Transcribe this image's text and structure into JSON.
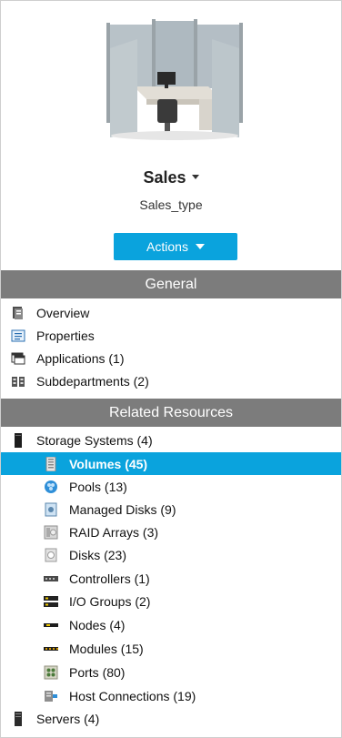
{
  "header": {
    "title": "Sales",
    "subtitle": "Sales_type",
    "actions_label": "Actions"
  },
  "sections": {
    "general": {
      "title": "General",
      "items": [
        {
          "label": "Overview",
          "icon": "overview-icon"
        },
        {
          "label": "Properties",
          "icon": "properties-icon"
        },
        {
          "label": "Applications (1)",
          "icon": "applications-icon"
        },
        {
          "label": "Subdepartments (2)",
          "icon": "subdepartments-icon"
        }
      ]
    },
    "related": {
      "title": "Related Resources",
      "storage": {
        "label": "Storage Systems (4)",
        "icon": "storage-system-icon"
      },
      "children": [
        {
          "label": "Volumes (45)",
          "icon": "volumes-icon",
          "selected": true
        },
        {
          "label": "Pools (13)",
          "icon": "pools-icon"
        },
        {
          "label": "Managed Disks (9)",
          "icon": "managed-disks-icon"
        },
        {
          "label": "RAID Arrays (3)",
          "icon": "raid-arrays-icon"
        },
        {
          "label": "Disks (23)",
          "icon": "disks-icon"
        },
        {
          "label": "Controllers (1)",
          "icon": "controllers-icon"
        },
        {
          "label": "I/O Groups (2)",
          "icon": "io-groups-icon"
        },
        {
          "label": "Nodes (4)",
          "icon": "nodes-icon"
        },
        {
          "label": "Modules (15)",
          "icon": "modules-icon"
        },
        {
          "label": "Ports (80)",
          "icon": "ports-icon"
        },
        {
          "label": "Host Connections (19)",
          "icon": "host-connections-icon"
        }
      ],
      "servers": {
        "label": "Servers (4)",
        "icon": "servers-icon"
      }
    }
  },
  "colors": {
    "accent": "#0aa3dd",
    "section_header_bg": "#7c7c7c"
  }
}
